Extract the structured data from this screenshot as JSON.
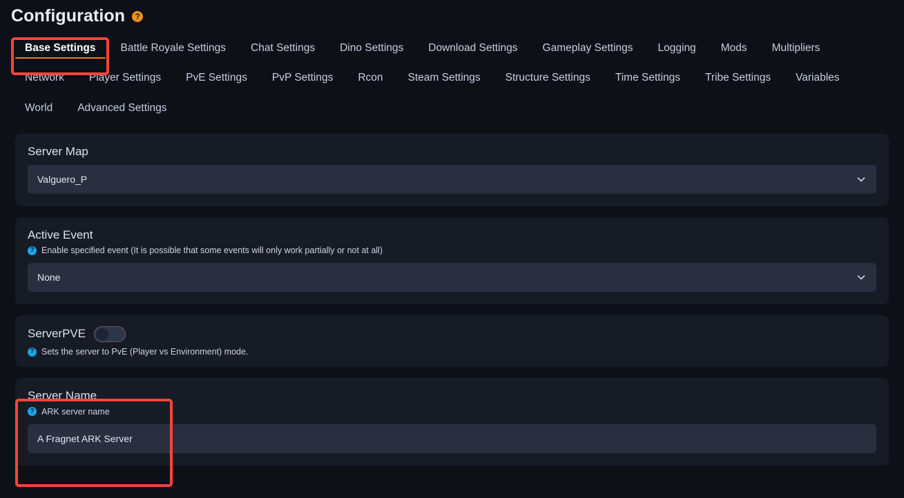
{
  "header": {
    "title": "Configuration",
    "help_icon": "question-mark-icon",
    "help_icon_color": "#f0901e"
  },
  "tabs": {
    "items": [
      {
        "label": "Base Settings",
        "active": true
      },
      {
        "label": "Battle Royale Settings",
        "active": false
      },
      {
        "label": "Chat Settings",
        "active": false
      },
      {
        "label": "Dino Settings",
        "active": false
      },
      {
        "label": "Download Settings",
        "active": false
      },
      {
        "label": "Gameplay Settings",
        "active": false
      },
      {
        "label": "Logging",
        "active": false
      },
      {
        "label": "Mods",
        "active": false
      },
      {
        "label": "Multipliers",
        "active": false
      },
      {
        "label": "Network",
        "active": false
      },
      {
        "label": "Player Settings",
        "active": false
      },
      {
        "label": "PvE Settings",
        "active": false
      },
      {
        "label": "PvP Settings",
        "active": false
      },
      {
        "label": "Rcon",
        "active": false
      },
      {
        "label": "Steam Settings",
        "active": false
      },
      {
        "label": "Structure Settings",
        "active": false
      },
      {
        "label": "Time Settings",
        "active": false
      },
      {
        "label": "Tribe Settings",
        "active": false
      },
      {
        "label": "Variables",
        "active": false
      },
      {
        "label": "World",
        "active": false
      },
      {
        "label": "Advanced Settings",
        "active": false
      }
    ],
    "active_underline_color": "#f08019"
  },
  "sections": {
    "server_map": {
      "title": "Server Map",
      "value": "Valguero_P",
      "dropdown_icon": "chevron-down-icon"
    },
    "active_event": {
      "title": "Active Event",
      "hint_icon": "question-mark-icon",
      "hint": "Enable specified event (It is possible that some events will only work partially or not at all)",
      "value": "None",
      "dropdown_icon": "chevron-down-icon"
    },
    "server_pve": {
      "title": "ServerPVE",
      "toggle_state": "off",
      "hint_icon": "question-mark-icon",
      "hint": "Sets the server to PvE (Player vs Environment) mode."
    },
    "server_name": {
      "title": "Server Name",
      "hint_icon": "question-mark-icon",
      "hint": "ARK server name",
      "value": "A Fragnet ARK Server"
    }
  },
  "annotations": {
    "color": "#f8443c",
    "boxes": [
      {
        "target": "Base Settings tab"
      },
      {
        "target": "Server Name section"
      }
    ]
  },
  "theme": {
    "page_background": "#0d1017",
    "card_background": "#171b26",
    "field_background": "#2a2e3f",
    "accent_orange": "#f08019",
    "hint_icon_blue": "#18a5e8",
    "annotation_red": "#f8443c"
  }
}
